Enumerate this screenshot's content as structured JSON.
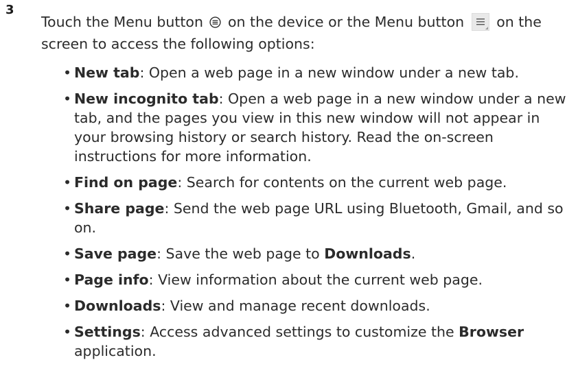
{
  "step": {
    "number": "3",
    "intro_part1": "Touch the Menu button",
    "intro_part2": "on the device or the Menu button",
    "intro_part3": "on the screen to access the following options:",
    "hw_icon": "menu-hardware-icon",
    "screen_icon": "menu-onscreen-icon"
  },
  "options": [
    {
      "term": "New tab",
      "desc": ": Open a web page in a new window under a new tab."
    },
    {
      "term": "New incognito tab",
      "desc": ": Open a web page in a new window under a new tab, and the pages you view in this new window will not appear in your browsing history or search history. Read the on-screen instructions for more information."
    },
    {
      "term": "Find on page",
      "desc": ": Search for contents on the current web page."
    },
    {
      "term": "Share page",
      "desc": ": Send the web page URL using Bluetooth, Gmail, and so on."
    },
    {
      "term": "Save page",
      "desc": ": Save the web page to ",
      "strong": "Downloads",
      "desc_after": "."
    },
    {
      "term": "Page info",
      "desc": ": View information about the current web page."
    },
    {
      "term": "Downloads",
      "desc": ": View and manage recent downloads."
    },
    {
      "term": "Settings",
      "desc": ": Access advanced settings to customize the ",
      "strong": "Browser",
      "desc_after": " application."
    }
  ],
  "bullet": "•"
}
